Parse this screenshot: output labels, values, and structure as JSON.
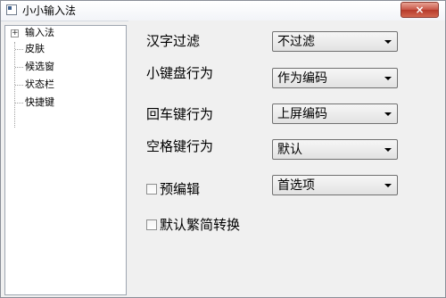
{
  "window": {
    "title": "小小输入法",
    "close_label": "×"
  },
  "tree": {
    "expander_symbol": "+",
    "items": [
      {
        "label": "输入法"
      },
      {
        "label": "皮肤"
      },
      {
        "label": "候选窗"
      },
      {
        "label": "状态栏"
      },
      {
        "label": "快捷键"
      }
    ]
  },
  "settings": {
    "hanzi_filter": {
      "label": "汉字过滤",
      "value": "不过滤"
    },
    "keypad_behavior": {
      "label": "小键盘行为",
      "value": "作为编码"
    },
    "enter_behavior": {
      "label": "回车键行为",
      "value": "上屏编码"
    },
    "space_behavior": {
      "label": "空格键行为",
      "value": "默认"
    },
    "pre_edit": {
      "label": "预编辑",
      "checked": false,
      "value": "首选项"
    },
    "default_traditional": {
      "label": "默认繁简转换",
      "checked": false
    }
  }
}
